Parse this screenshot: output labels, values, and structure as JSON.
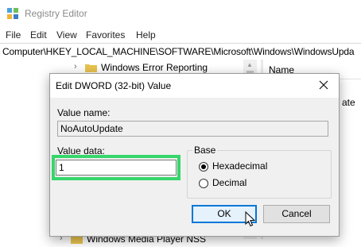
{
  "window": {
    "title": "Registry Editor",
    "menu": [
      "File",
      "Edit",
      "View",
      "Favorites",
      "Help"
    ],
    "address": "Computer\\HKEY_LOCAL_MACHINE\\SOFTWARE\\Microsoft\\Windows\\WindowsUpda",
    "tree": {
      "visible_item": "Windows Error Reporting",
      "bottom_item_partial": "Windows Media Player NSS"
    },
    "right_pane": {
      "column_name": "Name",
      "partial_value_text": "ate"
    }
  },
  "dialog": {
    "title": "Edit DWORD (32-bit) Value",
    "value_name_label": "Value name:",
    "value_name": "NoAutoUpdate",
    "value_data_label": "Value data:",
    "value_data": "1",
    "base": {
      "title": "Base",
      "options": [
        "Hexadecimal",
        "Decimal"
      ],
      "selected": "Hexadecimal"
    },
    "ok_label": "OK",
    "cancel_label": "Cancel",
    "highlight_color": "#36d66a",
    "accent_color": "#0078d7"
  }
}
